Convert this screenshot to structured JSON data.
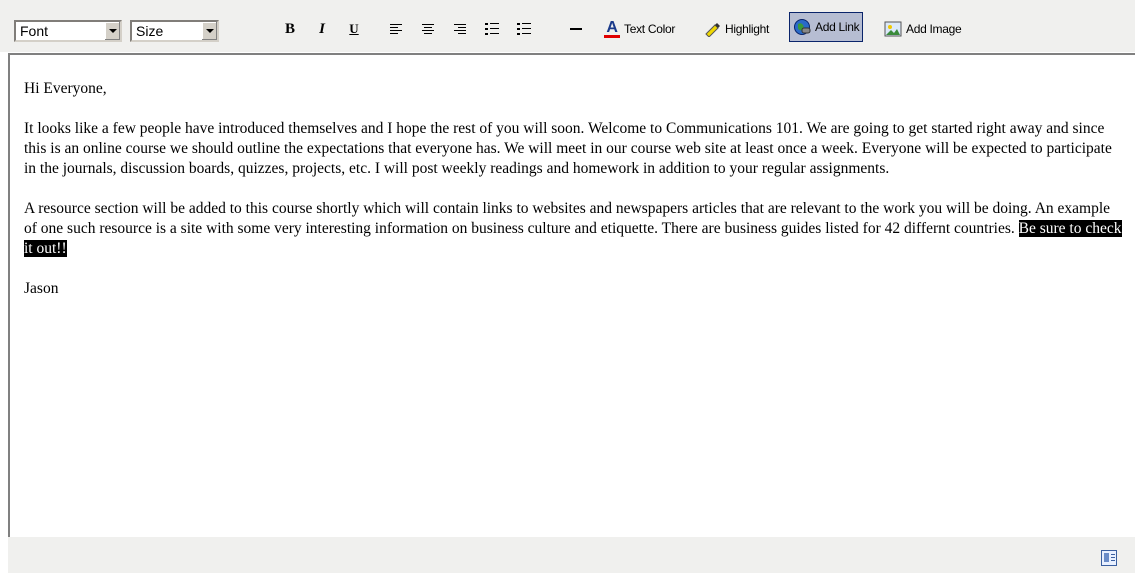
{
  "toolbar": {
    "font_select": {
      "value": "Font"
    },
    "size_select": {
      "value": "Size"
    },
    "bold_label": "B",
    "italic_label": "I",
    "underline_label": "U",
    "text_color_label": "Text Color",
    "highlight_label": "Highlight",
    "add_link_label": "Add Link",
    "add_image_label": "Add Image",
    "text_color_accent": "#e00000",
    "highlight_accent": "#f0d800"
  },
  "editor": {
    "greeting": "Hi Everyone,",
    "paragraph1": "It looks like a few people have introduced themselves and I hope the rest of you will soon. Welcome to Communications 101.  We are going to get started right away and since this is an online course we should outline the expectations that everyone has.  We will meet in our course web site at least once a week.  Everyone will be expected to participate in the journals, discussion boards, quizzes, projects, etc.  I will post weekly readings and homework in addition to your regular assignments.",
    "paragraph2_text": "A resource section will be added to this course shortly which will contain links to websites and newspapers articles that are relevant to the work you will be doing.  An example of one such resource is a site with some very interesting information on business culture and etiquette.  There are business guides listed for 42 differnt countries.  ",
    "paragraph2_selected": "Be sure to check it out!!",
    "signature": "Jason"
  },
  "status_bar": {
    "icon": "source-view-icon"
  }
}
